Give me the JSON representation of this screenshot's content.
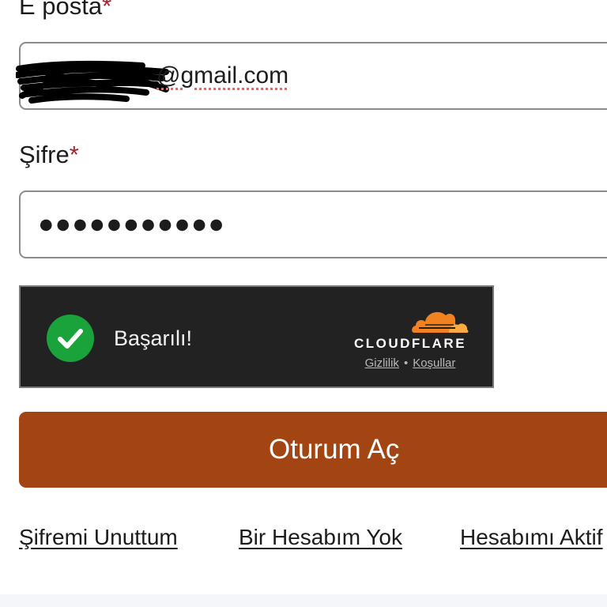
{
  "form": {
    "email_label": "E posta",
    "email_value": "@gmail.com",
    "password_label": "Şifre",
    "required_mark": "*",
    "password_mask": "●●●●●●●●●●●"
  },
  "captcha": {
    "status": "Başarılı!",
    "provider": "CLOUDFLARE",
    "privacy_link": "Gizlilik",
    "separator": "•",
    "terms_link": "Koşullar",
    "success_color": "#1aa33a",
    "brand_color": "#f48120"
  },
  "submit": {
    "label": "Oturum Aç",
    "color": "#a34513"
  },
  "links": {
    "forgot": "Şifremi Unuttum",
    "no_account": "Bir Hesabım Yok",
    "activate": "Hesabımı Aktif"
  },
  "icons": [
    "check-icon",
    "cloudflare-logo-icon"
  ]
}
